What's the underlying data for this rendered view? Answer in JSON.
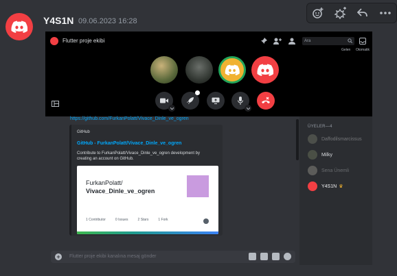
{
  "message": {
    "author": "Y4S1N",
    "timestamp": "09.06.2023 16:28"
  },
  "hover_actions": [
    "add-reaction-icon",
    "add-super-reaction-icon",
    "reply-icon",
    "more-icon"
  ],
  "call": {
    "channel_title": "Flutter proje ekibi",
    "search_placeholder": "Ara",
    "inbox_label": "Gelen",
    "auto_label": "Otomatik"
  },
  "chat": {
    "link": "https://github.com/FurkanPolatt/Vivace_Dinle_ve_ogren",
    "embed": {
      "provider": "GitHub",
      "title": "GitHub - FurkanPolatt/Vivace_Dinle_ve_ogren",
      "description": "Contribute to FurkanPolatt/Vivace_Dinle_ve_ogren development by creating an account on GitHub.",
      "image_user": "FurkanPolatt/",
      "image_repo": "Vivace_Dinle_ve_ogren",
      "stats": [
        {
          "value": "1",
          "label": "Contributor"
        },
        {
          "value": "0",
          "label": "Issues"
        },
        {
          "value": "2",
          "label": "Stars"
        },
        {
          "value": "1",
          "label": "Fork"
        }
      ]
    },
    "input_placeholder": "Flutter proje ekibi kanalına mesaj gönder"
  },
  "members": {
    "heading": "ÜYELER—4",
    "list": [
      {
        "name": "Daffodilsmarcissus",
        "color": "#f2f3f5",
        "dim": true
      },
      {
        "name": "Milky",
        "color": "#dbdee1",
        "dim": false
      },
      {
        "name": "Sena Ünemli",
        "color": "#dbdee1",
        "dim": true
      },
      {
        "name": "Y4S1N",
        "color": "#f2f3f5",
        "dim": false,
        "crown": "♛"
      }
    ]
  },
  "colors": {
    "accent_red": "#f23f43",
    "link_blue": "#00a8fc",
    "speaking_green": "#23a55a"
  }
}
